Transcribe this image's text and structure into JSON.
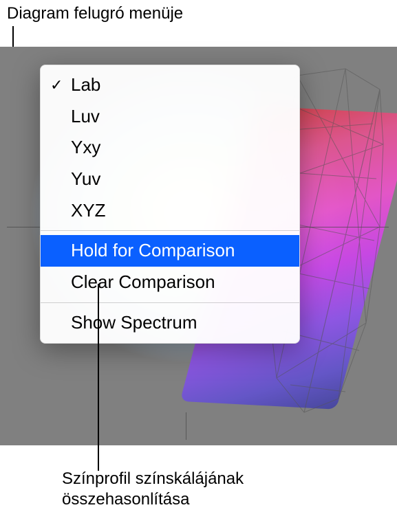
{
  "callouts": {
    "top": "Diagram felugró menüje",
    "bottom_line1": "Színprofil színskálájának",
    "bottom_line2": "összehasonlítása"
  },
  "menu": {
    "items": [
      {
        "label": "Lab",
        "checked": true
      },
      {
        "label": "Luv",
        "checked": false
      },
      {
        "label": "Yxy",
        "checked": false
      },
      {
        "label": "Yuv",
        "checked": false
      },
      {
        "label": "XYZ",
        "checked": false
      }
    ],
    "hold_comparison": "Hold for Comparison",
    "clear_comparison": "Clear Comparison",
    "show_spectrum": "Show Spectrum"
  },
  "icons": {
    "checkmark": "✓"
  }
}
